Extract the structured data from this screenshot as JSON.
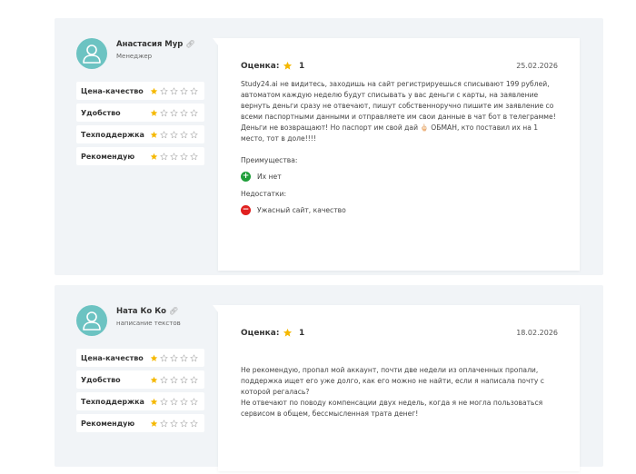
{
  "colors": {
    "star_filled": "#f5b800",
    "star_empty": "#b5b5b5",
    "avatar_bg": "#6cc3c2",
    "plus_green": "#1f9e3a",
    "minus_red": "#e0201f"
  },
  "reviews": [
    {
      "author": "Анастасия Мур",
      "role": "Менеджер",
      "ratings": [
        {
          "label": "Цена-качество",
          "stars": 1
        },
        {
          "label": "Удобство",
          "stars": 1
        },
        {
          "label": "Техподдержка",
          "stars": 1
        },
        {
          "label": "Рекомендую",
          "stars": 1
        }
      ],
      "score_label": "Оценка:",
      "score": "1",
      "date": "25.02.2026",
      "text": "Study24.ai не видитесь, заходишь на сайт регистрируешься списывают 199 рублей, автоматом каждую неделю будут списывать у вас деньги с карты, на заявление вернуть деньги сразу не отвечают, пишут собственноручно пишите им заявление со всеми паспортными данными и отправляете им свои данные в чат бот в телеграмме! Деньги не возвращают! Но паспорт им свой дай 🖕🏻 ОБМАН, кто поставил их на 1 место, тот в доле!!!!",
      "pros_title": "Преимущества:",
      "pros": "Их нет",
      "cons_title": "Недостатки:",
      "cons": "Ужасный сайт, качество"
    },
    {
      "author": "Ната Ко Ко",
      "role": "написание текстов",
      "ratings": [
        {
          "label": "Цена-качество",
          "stars": 1
        },
        {
          "label": "Удобство",
          "stars": 1
        },
        {
          "label": "Техподдержка",
          "stars": 1
        },
        {
          "label": "Рекомендую",
          "stars": 1
        }
      ],
      "score_label": "Оценка:",
      "score": "1",
      "date": "18.02.2026",
      "text": "Не рекомендую, пропал мой аккаунт, почти две недели из оплаченных пропали, поддержка ищет его уже долго, как его можно не найти, если я написала почту с которой регалась?\nНе отвечают по поводу компенсации двух недель, когда я не могла пользоваться сервисом в общем, бессмысленная трата денег!"
    }
  ]
}
